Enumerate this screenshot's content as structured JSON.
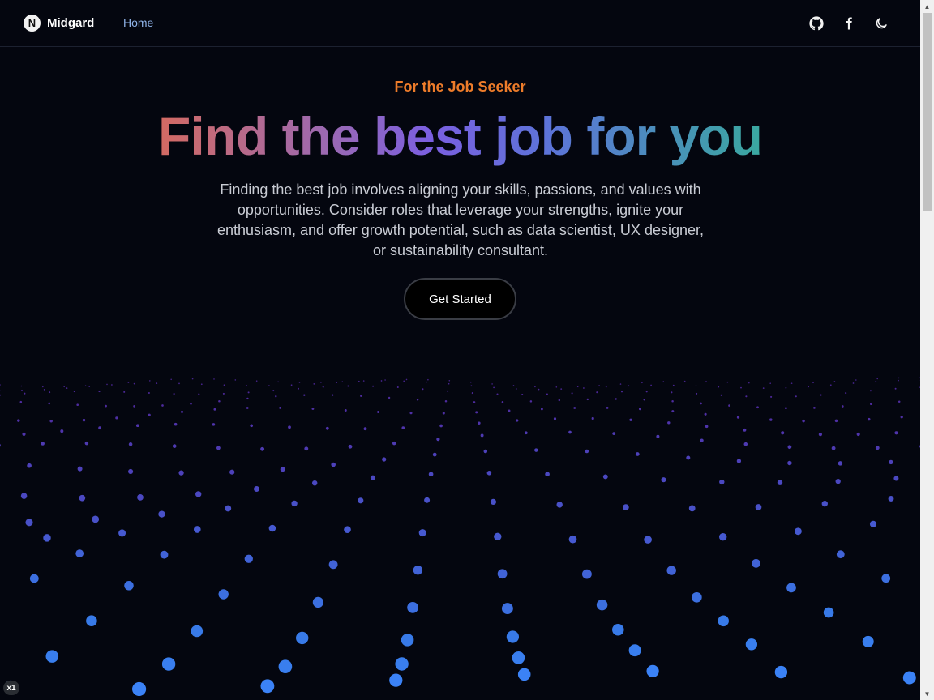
{
  "nav": {
    "brand_mark": "N",
    "brand_name": "Midgard",
    "home_link": "Home",
    "icons": [
      "github-icon",
      "facebook-icon",
      "moon-icon"
    ]
  },
  "hero": {
    "eyebrow": "For the Job Seeker",
    "headline": "Find the best job for you",
    "description": "Finding the best job involves aligning your skills, passions, and values with opportunities. Consider roles that leverage your strengths, ignite your enthusiasm, and offer growth potential, such as data scientist, UX designer, or sustainability consultant.",
    "cta_label": "Get Started"
  },
  "badge": "x1",
  "colors": {
    "background": "#04060f",
    "eyebrow": "#ee7c2a",
    "nav_link": "#8fb3e8",
    "particle_far": "#7c3aed",
    "particle_near": "#3b82f6"
  }
}
